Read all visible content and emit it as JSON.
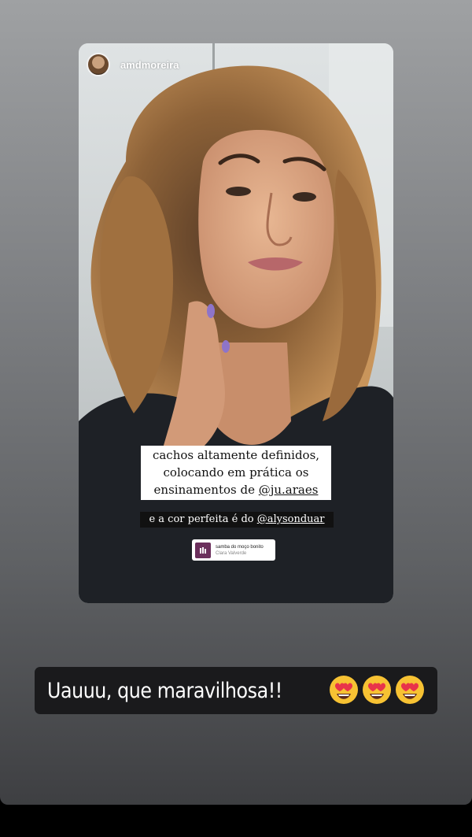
{
  "story": {
    "username": "amdmoreira",
    "caption_lines": [
      "cachos altamente definidos,",
      "colocando em prática os",
      "ensinamentos de "
    ],
    "caption_mention": "@ju.araes",
    "credit_prefix": "e a cor perfeita é do ",
    "credit_mention": "@alysonduar",
    "music": {
      "title": "samba do moço bonito",
      "artist": "Clara Valverde"
    }
  },
  "reply": {
    "text": "Uauuu, que maravilhosa!!",
    "emojis": [
      "smiling-face-with-heart-eyes",
      "smiling-face-with-heart-eyes",
      "smiling-face-with-heart-eyes"
    ]
  },
  "colors": {
    "reply_background": "#1a1a1c",
    "music_art": "#6b2f5c"
  }
}
